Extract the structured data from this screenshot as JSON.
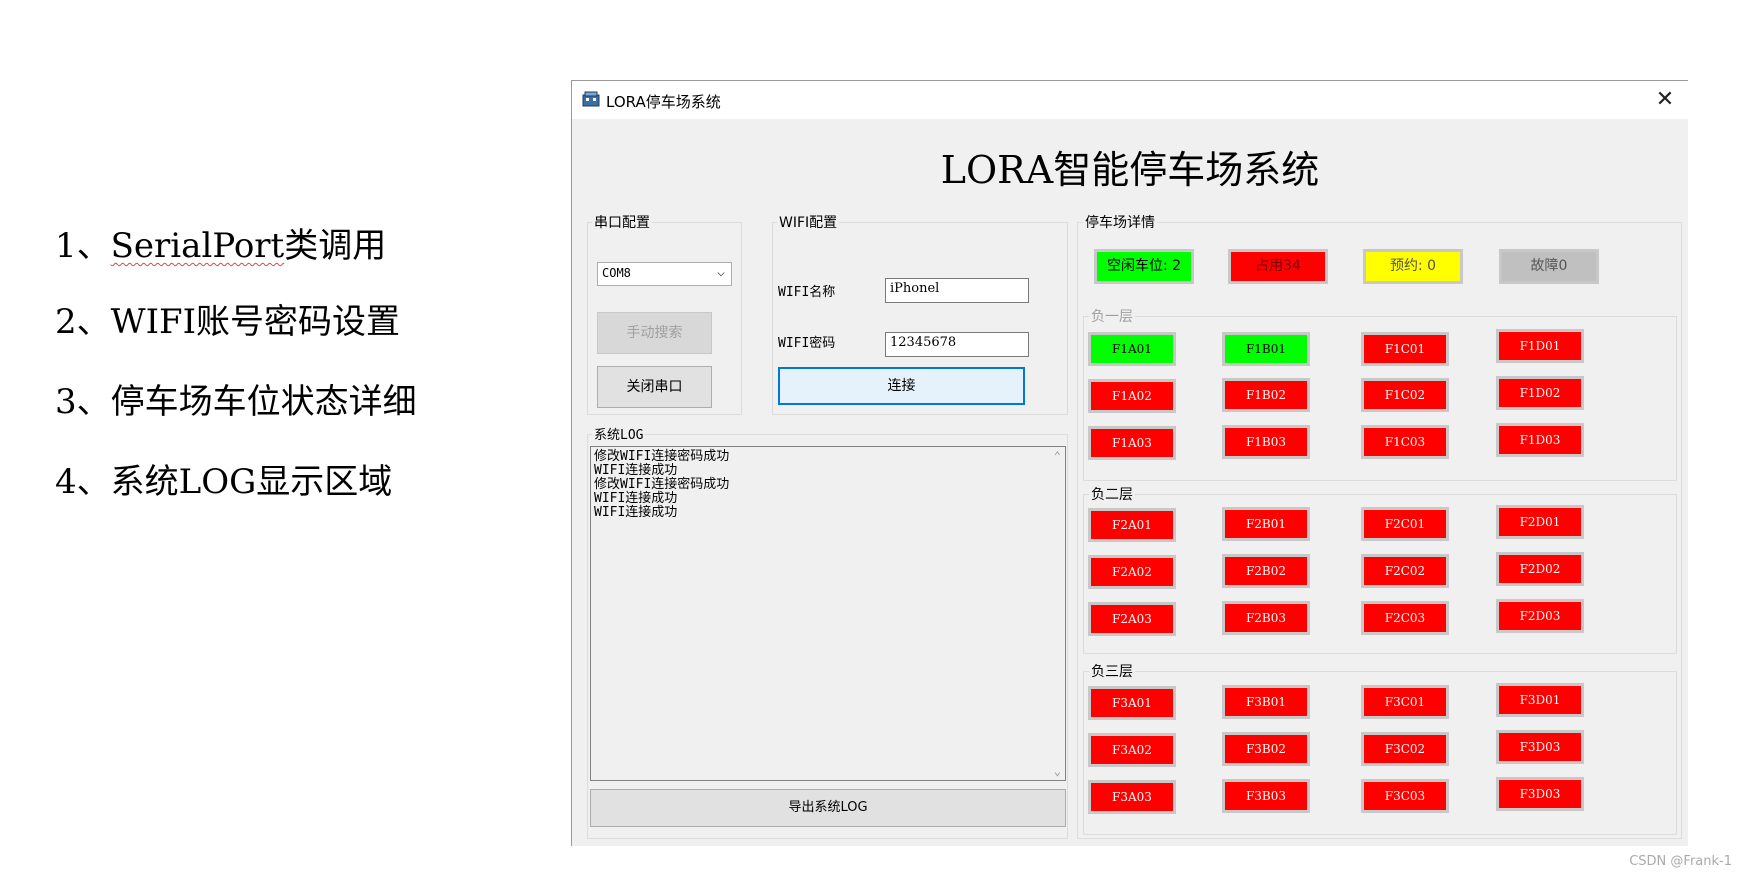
{
  "notes": [
    {
      "prefix": "1、",
      "underlined": "SerialPort",
      "suffix": "类调用"
    },
    {
      "prefix": "2、",
      "underlined": "",
      "suffix": "WIFI账号密码设置"
    },
    {
      "prefix": "3、",
      "underlined": "",
      "suffix": "停车场车位状态详细"
    },
    {
      "prefix": "4、",
      "underlined": "",
      "suffix": "系统LOG显示区域"
    }
  ],
  "window": {
    "title": "LORA停车场系统",
    "close_glyph": "✕",
    "heading": "LORA智能停车场系统"
  },
  "serial": {
    "group_label": "串口配置",
    "port_value": "COM8",
    "search_label": "手动搜索",
    "close_label": "关闭串口"
  },
  "wifi": {
    "group_label": "WIFI配置",
    "name_label": "WIFI名称",
    "name_value": "iPhonel",
    "password_label": "WIFI密码",
    "password_value": "12345678",
    "connect_label": "连接"
  },
  "log": {
    "group_label": "系统LOG",
    "lines": [
      "修改WIFI连接密码成功",
      "WIFI连接成功",
      "修改WIFI连接密码成功",
      "WIFI连接成功",
      "WIFI连接成功"
    ],
    "export_label": "导出系统LOG"
  },
  "parking": {
    "group_label": "停车场详情",
    "stats": {
      "free": "空闲车位: 2",
      "occupied": "占用34",
      "reserved": "预约: 0",
      "fault": "故障0"
    },
    "floors": [
      {
        "label": "负一层",
        "slots": [
          [
            "F1A01",
            "F1B01",
            "F1C01",
            "F1D01"
          ],
          [
            "F1A02",
            "F1B02",
            "F1C02",
            "F1D02"
          ],
          [
            "F1A03",
            "F1B03",
            "F1C03",
            "F1D03"
          ]
        ]
      },
      {
        "label": "负二层",
        "slots": [
          [
            "F2A01",
            "F2B01",
            "F2C01",
            "F2D01"
          ],
          [
            "F2A02",
            "F2B02",
            "F2C02",
            "F2D02"
          ],
          [
            "F2A03",
            "F2B03",
            "F2C03",
            "F2D03"
          ]
        ]
      },
      {
        "label": "负三层",
        "slots": [
          [
            "F3A01",
            "F3B01",
            "F3C01",
            "F3D01"
          ],
          [
            "F3A02",
            "F3B02",
            "F3C02",
            "F3D03"
          ],
          [
            "F3A03",
            "F3B03",
            "F3C03",
            "F3D03"
          ]
        ]
      }
    ],
    "free_slots": [
      "F1A01",
      "F1B01"
    ],
    "colors": {
      "free": "#00ff00",
      "occupied": "#ff0000",
      "reserved": "#ffff00",
      "fault": "#c0c0c0"
    }
  },
  "watermark": "CSDN @Frank-1"
}
